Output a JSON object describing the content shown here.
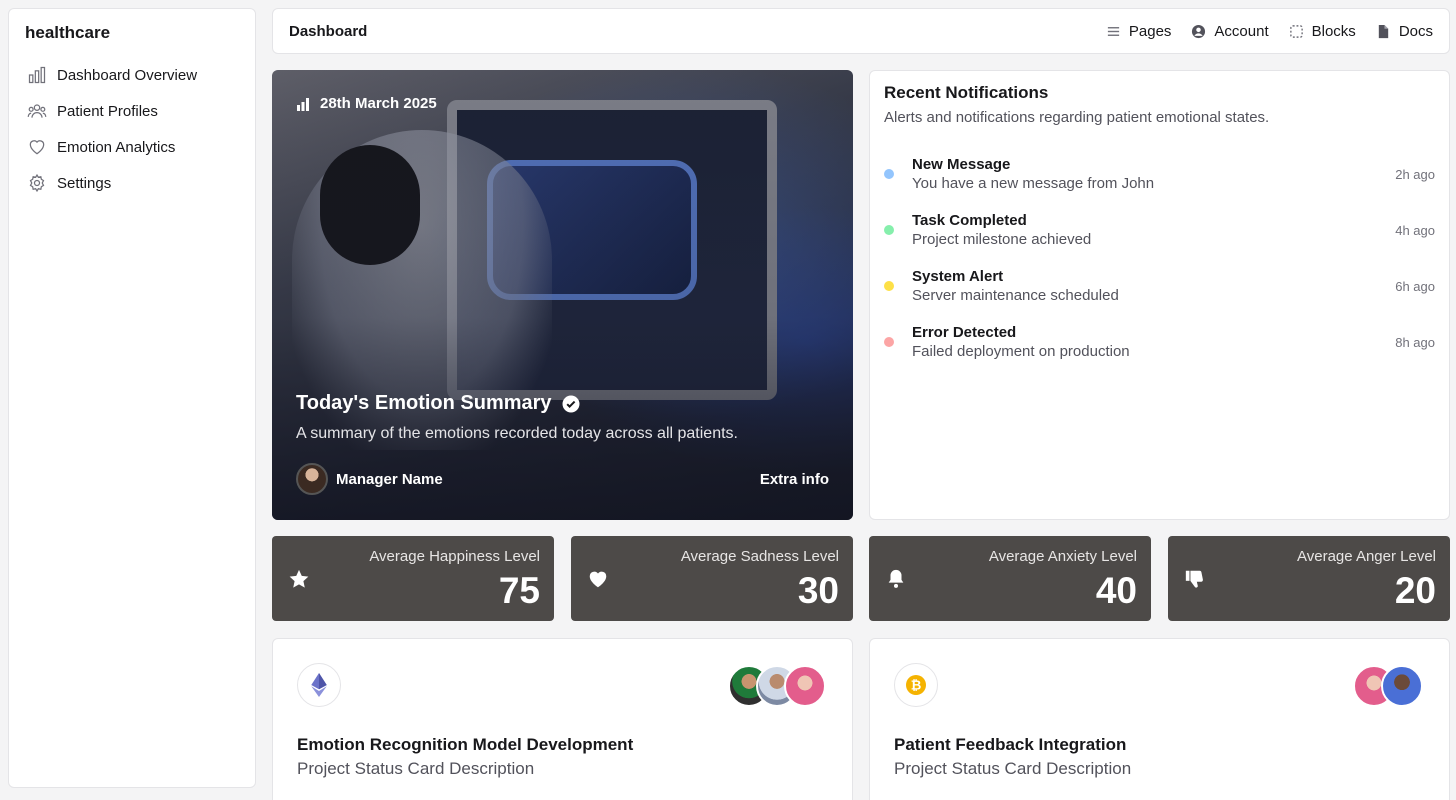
{
  "sidebar": {
    "brand": "healthcare",
    "items": [
      {
        "label": "Dashboard Overview",
        "icon": "bar-chart-icon"
      },
      {
        "label": "Patient Profiles",
        "icon": "users-icon"
      },
      {
        "label": "Emotion Analytics",
        "icon": "heart-icon"
      },
      {
        "label": "Settings",
        "icon": "gear-icon"
      }
    ]
  },
  "topbar": {
    "title": "Dashboard",
    "nav": [
      {
        "label": "Pages",
        "icon": "menu-icon"
      },
      {
        "label": "Account",
        "icon": "user-circle-icon"
      },
      {
        "label": "Blocks",
        "icon": "blocks-icon"
      },
      {
        "label": "Docs",
        "icon": "document-icon"
      }
    ]
  },
  "hero": {
    "date": "28th March 2025",
    "title": "Today's Emotion Summary",
    "description": "A summary of the emotions recorded today across all patients.",
    "manager": "Manager Name",
    "extra": "Extra info"
  },
  "notifications": {
    "title": "Recent Notifications",
    "subtitle": "Alerts and notifications regarding patient emotional states.",
    "items": [
      {
        "name": "New Message",
        "message": "You have a new message from John",
        "time": "2h ago",
        "color": "#93c5fd"
      },
      {
        "name": "Task Completed",
        "message": "Project milestone achieved",
        "time": "4h ago",
        "color": "#86efac"
      },
      {
        "name": "System Alert",
        "message": "Server maintenance scheduled",
        "time": "6h ago",
        "color": "#fde047"
      },
      {
        "name": "Error Detected",
        "message": "Failed deployment on production",
        "time": "8h ago",
        "color": "#fca5a5"
      }
    ]
  },
  "stats": [
    {
      "label": "Average Happiness Level",
      "value": "75",
      "icon": "star-icon"
    },
    {
      "label": "Average Sadness Level",
      "value": "30",
      "icon": "heart-icon"
    },
    {
      "label": "Average Anxiety Level",
      "value": "40",
      "icon": "bell-icon"
    },
    {
      "label": "Average Anger Level",
      "value": "20",
      "icon": "thumbs-down-icon"
    }
  ],
  "projects": [
    {
      "title": "Emotion Recognition Model Development",
      "description": "Project Status Card Description",
      "icon": "ethereum-icon"
    },
    {
      "title": "Patient Feedback Integration",
      "description": "Project Status Card Description",
      "icon": "bitcoin-icon"
    }
  ],
  "colors": {
    "stat_bg": "#4d4a48",
    "page_bg": "#f4f4f5"
  }
}
